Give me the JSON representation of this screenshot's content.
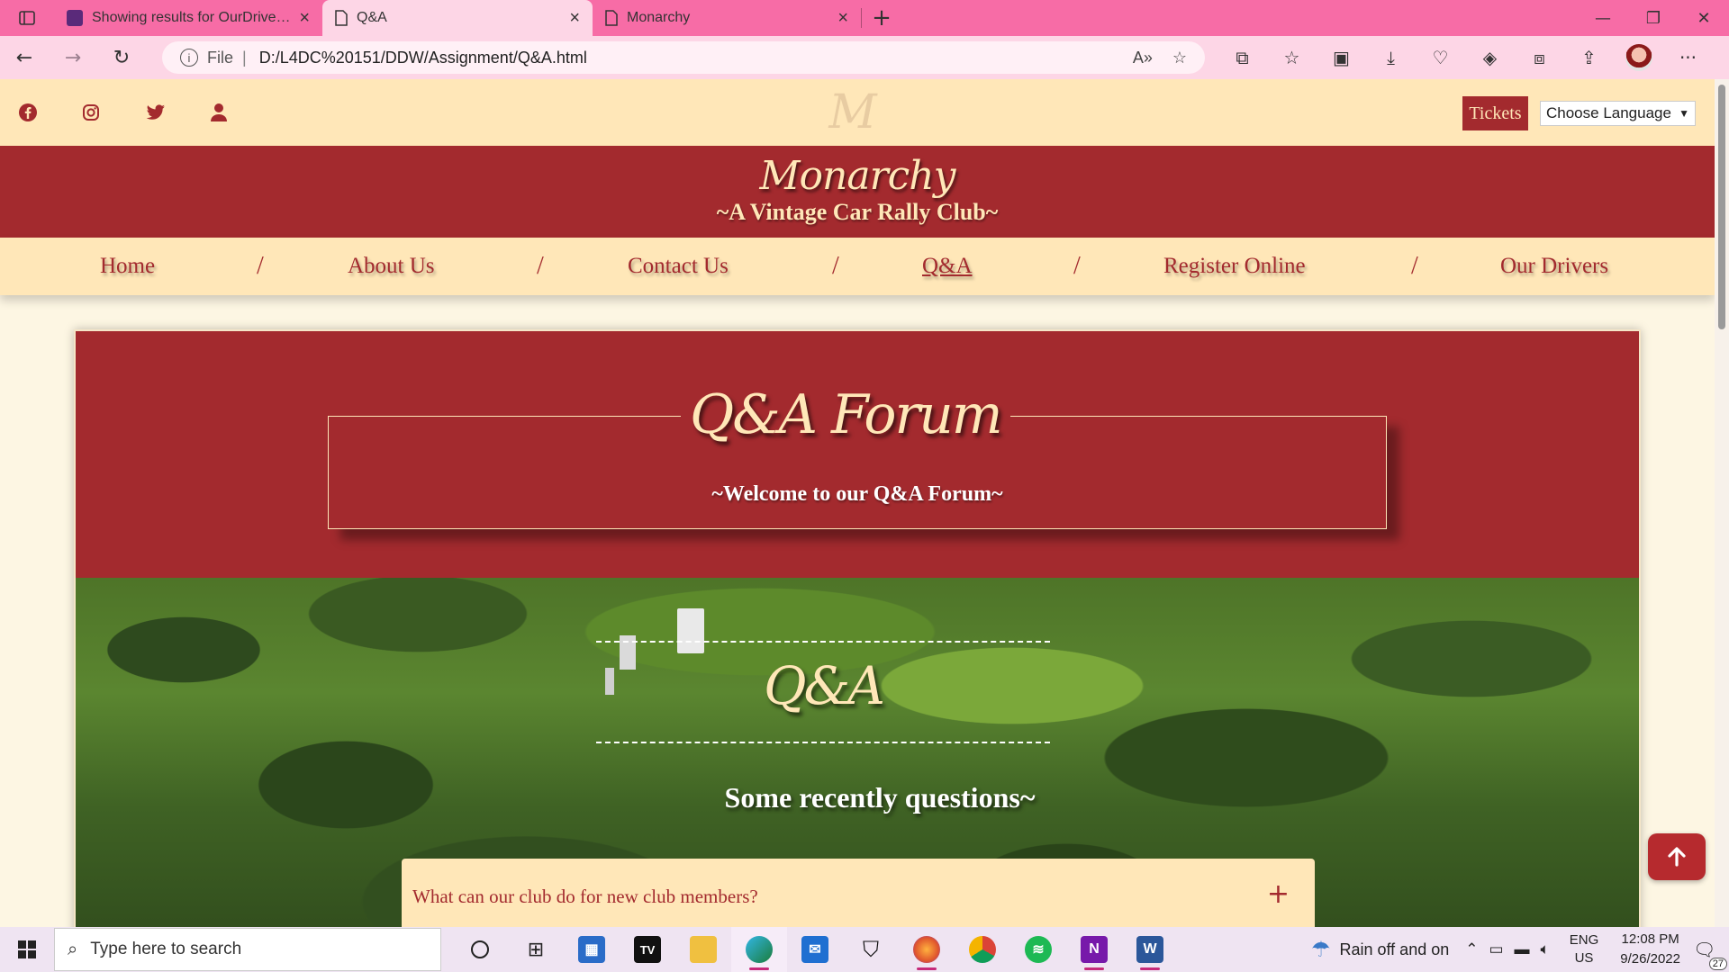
{
  "browser": {
    "tabs": [
      {
        "title": "Showing results for OurDrivers.h",
        "active": false
      },
      {
        "title": "Q&A",
        "active": true
      },
      {
        "title": "Monarchy",
        "active": false
      }
    ],
    "address": {
      "file_label": "File",
      "url": "D:/L4DC%20151/DDW/Assignment/Q&A.html"
    }
  },
  "site": {
    "logo_glyph": "M",
    "tickets_label": "Tickets",
    "language_select": "Choose Language",
    "brand_name": "Monarchy",
    "brand_tagline": "~A Vintage Car Rally Club~",
    "nav": [
      {
        "label": "Home"
      },
      {
        "label": "About Us"
      },
      {
        "label": "Contact Us"
      },
      {
        "label": "Q&A",
        "current": true
      },
      {
        "label": "Register Online"
      },
      {
        "label": "Our Drivers"
      }
    ],
    "nav_separator": "/"
  },
  "forum": {
    "title": "Q&A Forum",
    "subtitle": "~Welcome to our Q&A Forum~",
    "section_title": "Q&A",
    "recent_heading": "Some recently questions~",
    "faq": [
      {
        "question": "What can our club do for new club members?",
        "toggle": "+"
      }
    ]
  },
  "taskbar": {
    "search_placeholder": "Type here to search",
    "weather": "Rain off and on",
    "lang_line1": "ENG",
    "lang_line2": "US",
    "time": "12:08 PM",
    "date": "9/26/2022",
    "notifications": "27"
  },
  "colors": {
    "brand_red": "#a32a2e",
    "cream": "#ffe7b8",
    "browser_pink": "#f76ca6"
  }
}
